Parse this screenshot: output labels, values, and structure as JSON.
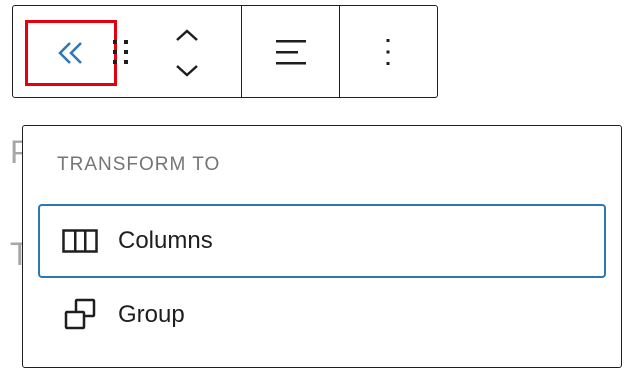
{
  "toolbar": {
    "parent_icon": "chevron-double-left-icon",
    "drag_icon": "drag-handle-icon",
    "move_icon": "chevron-up-down-icon",
    "align_icon": "align-left-icon",
    "more_icon": "more-vertical-icon"
  },
  "background": {
    "letters": [
      "P",
      "T"
    ]
  },
  "popover": {
    "heading": "TRANSFORM TO",
    "items": [
      {
        "label": "Columns",
        "icon": "columns-icon",
        "active": true
      },
      {
        "label": "Group",
        "icon": "group-icon",
        "active": false
      }
    ]
  },
  "colors": {
    "accent": "#2c77b6",
    "highlight": "#e3000f",
    "text": "#1e1e1e",
    "muted": "#757575"
  }
}
